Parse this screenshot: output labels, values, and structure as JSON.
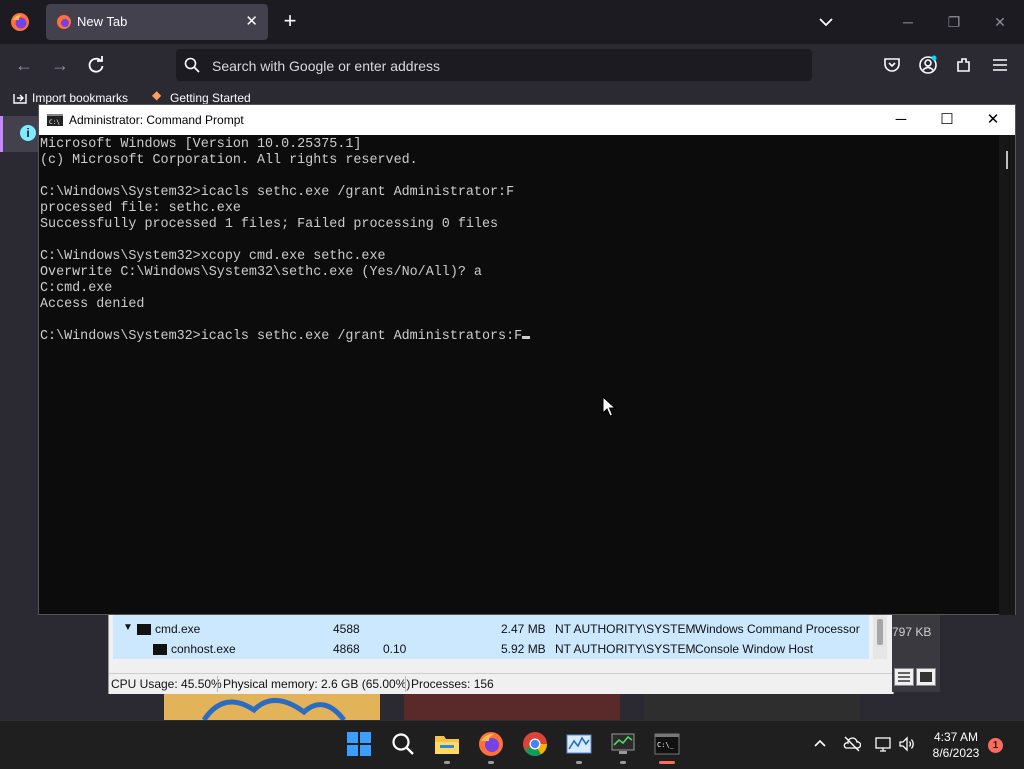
{
  "browser": {
    "tab_title": "New Tab",
    "search_placeholder": "Search with Google or enter address",
    "bookmarks": [
      "Import bookmarks",
      "Getting Started"
    ]
  },
  "cmd": {
    "window_title": "Administrator: Command Prompt",
    "lines": [
      "Microsoft Windows [Version 10.0.25375.1]",
      "(c) Microsoft Corporation. All rights reserved.",
      "",
      "C:\\Windows\\System32>icacls sethc.exe /grant Administrator:F",
      "processed file: sethc.exe",
      "Successfully processed 1 files; Failed processing 0 files",
      "",
      "C:\\Windows\\System32>xcopy cmd.exe sethc.exe",
      "Overwrite C:\\Windows\\System32\\sethc.exe (Yes/No/All)? a",
      "C:cmd.exe",
      "Access denied",
      "",
      "C:\\Windows\\System32>icacls sethc.exe /grant Administrators:F"
    ]
  },
  "taskmgr": {
    "rows": [
      {
        "name": "cmd.exe",
        "pid": "4588",
        "cpu": "",
        "memory": "2.47 MB",
        "user": "NT AUTHORITY\\SYSTEM",
        "description": "Windows Command Processor"
      },
      {
        "name": "conhost.exe",
        "pid": "4868",
        "cpu": "0.10",
        "memory": "5.92 MB",
        "user": "NT AUTHORITY\\SYSTEM",
        "description": "Console Window Host"
      }
    ],
    "status": {
      "cpu": "CPU Usage: 45.50%",
      "memory": "Physical memory: 2.6 GB (65.00%)",
      "processes": "Processes: 156"
    },
    "side_memory": "797 KB"
  },
  "taskbar": {
    "time": "4:37 AM",
    "date": "8/6/2023",
    "notification_count": "1"
  },
  "colors": {
    "accent": "#ff6b5b",
    "terminal_bg": "#0c0c0c",
    "terminal_fg": "#cccccc"
  }
}
